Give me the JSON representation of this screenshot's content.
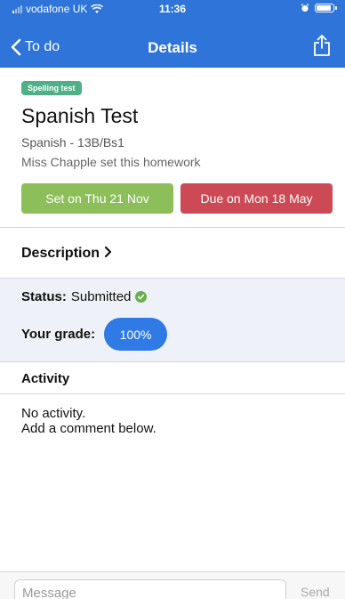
{
  "status_bar": {
    "carrier": "vodafone UK",
    "time": "11:36"
  },
  "nav": {
    "back_label": "To do",
    "title": "Details"
  },
  "homework": {
    "tag": "Spelling test",
    "title": "Spanish Test",
    "class": "Spanish - 13B/Bs1",
    "teacher_note": "Miss Chapple set this homework",
    "set_label": "Set on Thu 21 Nov",
    "due_label": "Due on Mon 18 May"
  },
  "description": {
    "label": "Description",
    "chevron": "›"
  },
  "status": {
    "label": "Status:",
    "value": "Submitted",
    "grade_label": "Your grade:",
    "grade_value": "100%"
  },
  "activity": {
    "title": "Activity",
    "empty_line1": "No activity.",
    "empty_line2": "Add a comment below."
  },
  "composer": {
    "placeholder": "Message",
    "send_label": "Send"
  },
  "colors": {
    "header": "#2f74d8",
    "tag": "#4fb087",
    "set_button": "#8cbf59",
    "due_button": "#cc4a55",
    "grade_pill": "#2f7ae5",
    "status_check": "#6ab04c"
  },
  "icons": [
    "wifi-icon",
    "alarm-icon",
    "battery-icon",
    "back-chevron-icon",
    "share-icon",
    "check-icon",
    "chevron-right-icon"
  ]
}
